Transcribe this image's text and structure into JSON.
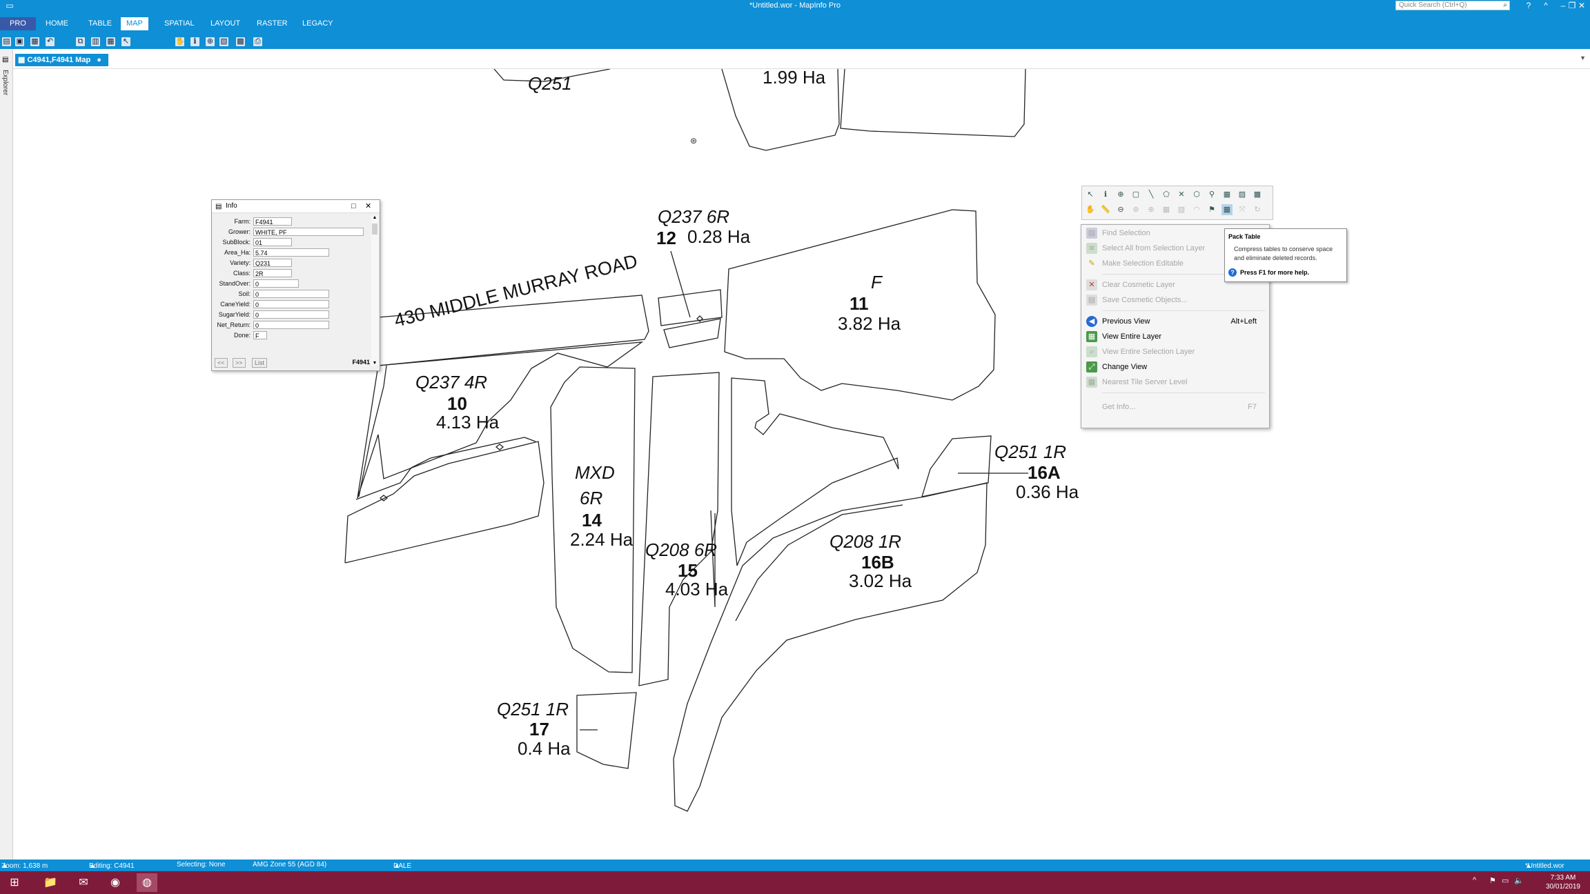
{
  "window": {
    "title": "*Untitled.wor - MapInfo Pro",
    "search_placeholder": "Quick Search (Ctrl+Q)",
    "help": "?",
    "ribbon_min": "^",
    "minimize": "–",
    "restore": "❐",
    "close": "✕"
  },
  "ribbon": {
    "tabs": [
      "PRO",
      "HOME",
      "TABLE",
      "MAP",
      "SPATIAL",
      "LAYOUT",
      "RASTER",
      "LEGACY"
    ],
    "active_tab": "MAP"
  },
  "sidebar": {
    "label": "Explorer"
  },
  "doc_tab": {
    "label": "C4941,F4941 Map",
    "pin": "●"
  },
  "map": {
    "road_label": "430 MIDDLE MURRAY ROAD",
    "blocks": [
      {
        "variety": "Q251",
        "block": "",
        "area": ""
      },
      {
        "variety": "",
        "block": "",
        "area": "1.99 Ha"
      },
      {
        "variety": "Q237 6R",
        "block": "12",
        "area": "0.28 Ha"
      },
      {
        "variety": "F",
        "block": "11",
        "area": "3.82 Ha"
      },
      {
        "variety": "Q237 4R",
        "block": "10",
        "area": "4.13 Ha"
      },
      {
        "variety": "MXD",
        "class": "6R",
        "block": "14",
        "area": "2.24 Ha"
      },
      {
        "variety": "Q208 6R",
        "block": "15",
        "area": "4.03 Ha"
      },
      {
        "variety": "Q251 1R",
        "block": "16A",
        "area": "0.36 Ha"
      },
      {
        "variety": "Q208 1R",
        "block": "16B",
        "area": "3.02 Ha"
      },
      {
        "variety": "Q251 1R",
        "block": "17",
        "area": "0.4 Ha"
      }
    ]
  },
  "info": {
    "title": "Info",
    "fields": [
      {
        "label": "Farm:",
        "value": "F4941"
      },
      {
        "label": "Grower:",
        "value": "WHITE, PF"
      },
      {
        "label": "SubBlock:",
        "value": "01"
      },
      {
        "label": "Area_Ha:",
        "value": "5.74"
      },
      {
        "label": "Variety:",
        "value": "Q231"
      },
      {
        "label": "Class:",
        "value": "2R"
      },
      {
        "label": "StandOver:",
        "value": "0"
      },
      {
        "label": "Soil:",
        "value": "0"
      },
      {
        "label": "CaneYield:",
        "value": "0"
      },
      {
        "label": "SugarYield:",
        "value": "0"
      },
      {
        "label": "Net_Return:",
        "value": "0"
      },
      {
        "label": "Done:",
        "value": "F"
      }
    ],
    "prev": "<<",
    "next": ">>",
    "list": "List",
    "record": "F4941"
  },
  "context_menu": {
    "items": [
      {
        "label": "Find Selection",
        "shortcut": "",
        "enabled": false
      },
      {
        "label": "Select All from Selection Layer",
        "shortcut": "",
        "enabled": false
      },
      {
        "label": "Make Selection Editable",
        "shortcut": "",
        "enabled": false
      },
      {
        "label": "Clear Cosmetic Layer",
        "shortcut": "",
        "enabled": false
      },
      {
        "label": "Save Cosmetic Objects...",
        "shortcut": "",
        "enabled": false
      },
      {
        "label": "Previous View",
        "shortcut": "Alt+Left",
        "enabled": true
      },
      {
        "label": "View Entire Layer",
        "shortcut": "",
        "enabled": true
      },
      {
        "label": "View Entire Selection Layer",
        "shortcut": "",
        "enabled": false
      },
      {
        "label": "Change View",
        "shortcut": "",
        "enabled": true
      },
      {
        "label": "Nearest Tile Server Level",
        "shortcut": "",
        "enabled": false
      },
      {
        "label": "Get Info...",
        "shortcut": "F7",
        "enabled": false
      }
    ]
  },
  "tooltip": {
    "title": "Pack Table",
    "body": "Compress tables to conserve space and eliminate deleted records.",
    "footer": "Press F1 for more help."
  },
  "status": {
    "zoom": "Zoom: 1,638 m",
    "editing": "Editing: C4941",
    "selecting": "Selecting: None",
    "projection": "AMG Zone 55 (AGD 84)",
    "user": "DALE",
    "workspace": "*Untitled.wor"
  },
  "taskbar": {
    "time": "7:33 AM",
    "date": "30/01/2019"
  },
  "colors": {
    "accent": "#0e8fd6",
    "pro_tab": "#3a58a8",
    "taskbar": "#7e1b3b"
  }
}
